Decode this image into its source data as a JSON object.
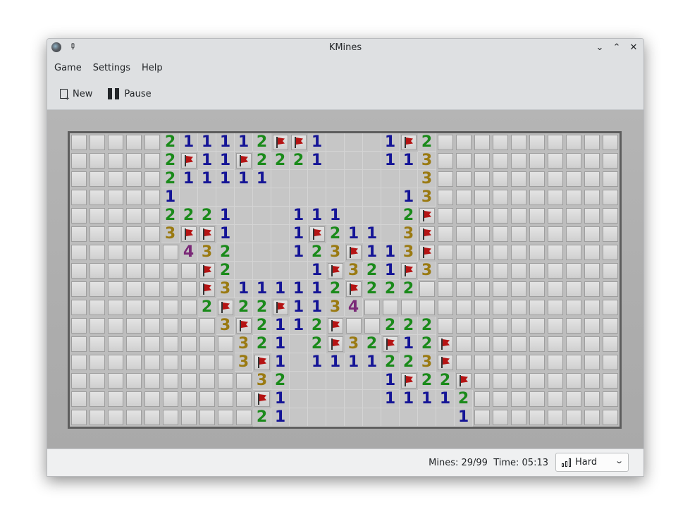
{
  "window": {
    "title": "KMines",
    "icons": {
      "app": "kmines-mine-icon",
      "pin": "pin-icon"
    },
    "controls": {
      "minimize": "⌄",
      "maximize": "⌃",
      "close": "✕"
    }
  },
  "menubar": [
    "Game",
    "Settings",
    "Help"
  ],
  "toolbar": {
    "new_label": "New",
    "pause_label": "Pause"
  },
  "board": {
    "columns": 30,
    "rows_count": 16,
    "legend": {
      "#": "hidden",
      "F": "flag",
      ".": "revealed-empty",
      "1-8": "mine-count"
    },
    "number_colors": {
      "1": "#141496",
      "2": "#1a8a1a",
      "3": "#9a7a12",
      "4": "#7a2877"
    },
    "rows": [
      "#####211112FF1...1F2##########",
      "#####2F11F2221...113##########",
      "#####211111........3##########",
      "#####1............13##########",
      "#####2221...111...2F##########",
      "#####3FF1...1F211.3F##########",
      "######432...123F113F##########",
      "#######F2....1F321F3##########",
      "#######F3111112F222###########",
      "#######2F22F1134##############",
      "########3F2112F##222##########",
      "#########321.2F32F12F#########",
      "#########3F1.1111223F#########",
      "##########32.....1F22F########",
      "##########F1.....11112########",
      "##########21.........1########"
    ]
  },
  "status": {
    "mines_label": "Mines:",
    "mines_value": "29/99",
    "time_label": "Time:",
    "time_value": "05:13",
    "text": "Mines: 29/99  Time: 05:13",
    "difficulty": "Hard"
  }
}
